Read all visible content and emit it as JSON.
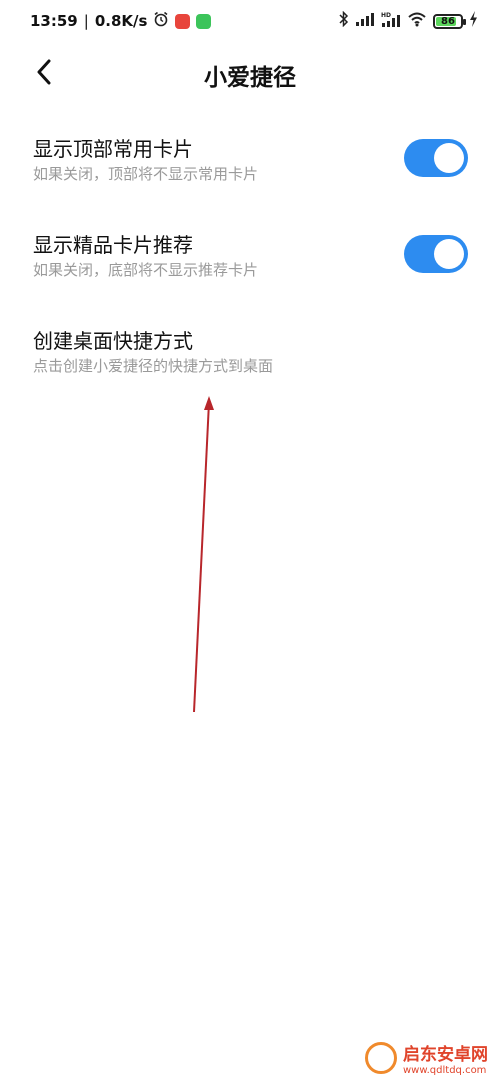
{
  "status_bar": {
    "time": "13:59",
    "separator": "|",
    "speed": "0.8K/s",
    "battery_level": "86",
    "battery_fraction": 0.86,
    "icons": [
      "alarm-clock-icon",
      "bluetooth-icon",
      "signal-icon",
      "hd-signal-icon",
      "wifi-icon",
      "charging-bolt-icon"
    ]
  },
  "header": {
    "title": "小爱捷径",
    "back_icon": "chevron-left-icon"
  },
  "settings": [
    {
      "title": "显示顶部常用卡片",
      "subtitle": "如果关闭，顶部将不显示常用卡片",
      "toggle": true
    },
    {
      "title": "显示精品卡片推荐",
      "subtitle": "如果关闭，底部将不显示推荐卡片",
      "toggle": true
    },
    {
      "title": "创建桌面快捷方式",
      "subtitle": "点击创建小爱捷径的快捷方式到桌面"
    }
  ],
  "watermark": {
    "name": "启东安卓网",
    "url": "www.qdltdq.com"
  },
  "colors": {
    "accent": "#2d8cf0",
    "subtitle": "#9a9a9a",
    "annotation_arrow": "#b8262b",
    "battery_fill": "#5cd65c"
  }
}
